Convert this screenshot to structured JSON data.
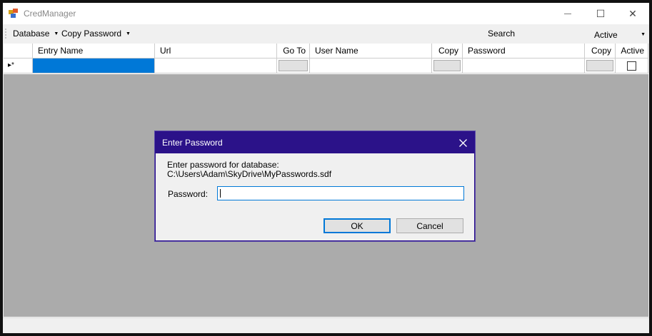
{
  "window": {
    "title": "CredManager",
    "minimize_glyph": "—",
    "maximize_glyph": "☐",
    "close_glyph": "✕"
  },
  "menubar": {
    "database_label": "Database",
    "copy_password_label": "Copy Password",
    "search_label": "Search:",
    "search_value": "",
    "filter_value": "Active"
  },
  "grid": {
    "columns": [
      "Entry Name",
      "Url",
      "Go To",
      "User Name",
      "Copy",
      "Password",
      "Copy",
      "Active"
    ],
    "new_row_indicator": "▸*",
    "active_checked": false
  },
  "dialog": {
    "title": "Enter Password",
    "message_line1": "Enter password for database:",
    "message_line2": "C:\\Users\\Adam\\SkyDrive\\MyPasswords.sdf",
    "password_label": "Password:",
    "password_value": "",
    "ok_label": "OK",
    "cancel_label": "Cancel"
  },
  "icons": {
    "app": "app-icon",
    "close": "close-icon"
  },
  "colors": {
    "dialog_title_bg": "#2b1289",
    "selection": "#0078d7",
    "grid_bg": "#ababab"
  }
}
